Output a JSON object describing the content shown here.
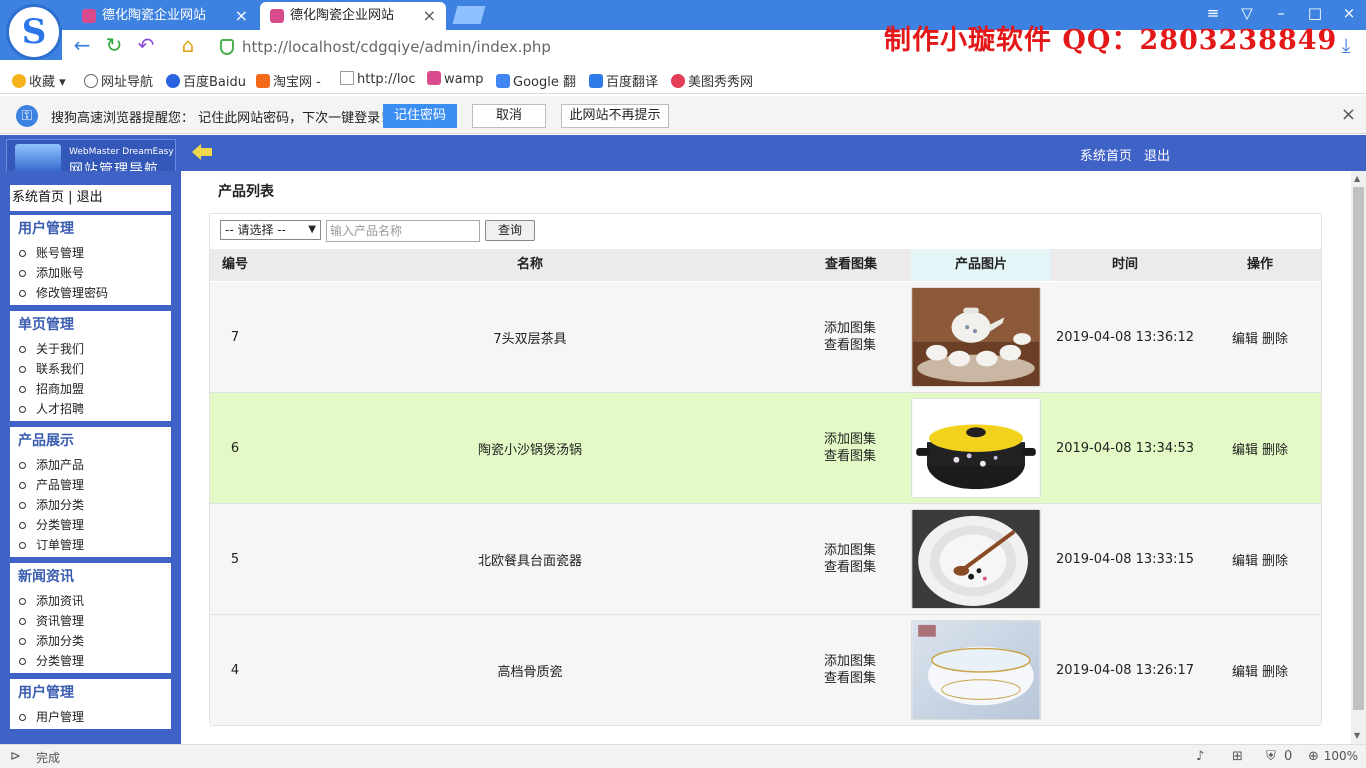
{
  "browser": {
    "logo_letter": "S",
    "tabs": [
      {
        "title": "德化陶瓷企业网站"
      },
      {
        "title": "德化陶瓷企业网站"
      }
    ],
    "url": "http://localhost/cdgqiye/admin/index.php",
    "promo_text": "制作小璇软件 QQ：2803238849",
    "bookmarks": [
      "收藏",
      "网址导航",
      "百度Baidu",
      "淘宝网 -",
      "http://loc",
      "wamp",
      "Google 翻",
      "百度翻译",
      "美图秀秀网"
    ],
    "password_bar": {
      "message": "搜狗高速浏览器提醒您： 记住此网站密码，下次一键登录！",
      "remember": "记住密码",
      "cancel": "取消",
      "never": "此网站不再提示"
    },
    "status": "完成",
    "zoom": "100%",
    "blocked_count": "0"
  },
  "app": {
    "brand_en": "WebMaster DreamEasy",
    "brand_zh": "网站管理导航",
    "top_links": [
      "系统首页",
      "退出"
    ],
    "side_head": [
      "系统首页",
      "退出"
    ],
    "menus": [
      {
        "title": "用户管理",
        "items": [
          "账号管理",
          "添加账号",
          "修改管理密码"
        ]
      },
      {
        "title": "单页管理",
        "items": [
          "关于我们",
          "联系我们",
          "招商加盟",
          "人才招聘"
        ]
      },
      {
        "title": "产品展示",
        "items": [
          "添加产品",
          "产品管理",
          "添加分类",
          "分类管理",
          "订单管理"
        ]
      },
      {
        "title": "新闻资讯",
        "items": [
          "添加资讯",
          "资讯管理",
          "添加分类",
          "分类管理"
        ]
      },
      {
        "title": "用户管理",
        "items": [
          "用户管理"
        ]
      }
    ],
    "page_title": "产品列表",
    "search": {
      "select_value": "-- 请选择 --",
      "placeholder": "输入产品名称",
      "button": "查询"
    },
    "columns": [
      "编号",
      "名称",
      "查看图集",
      "产品图片",
      "时间",
      "操作"
    ],
    "rows": [
      {
        "id": "7",
        "name": "7头双层茶具",
        "add_gallery": "添加图集",
        "view_gallery": "查看图集",
        "time": "2019-04-08 13:36:12",
        "edit": "编辑",
        "delete": "删除",
        "highlight": false
      },
      {
        "id": "6",
        "name": "陶瓷小沙锅煲汤锅",
        "add_gallery": "添加图集",
        "view_gallery": "查看图集",
        "time": "2019-04-08 13:34:53",
        "edit": "编辑",
        "delete": "删除",
        "highlight": true
      },
      {
        "id": "5",
        "name": "北欧餐具台面瓷器",
        "add_gallery": "添加图集",
        "view_gallery": "查看图集",
        "time": "2019-04-08 13:33:15",
        "edit": "编辑",
        "delete": "删除",
        "highlight": false
      },
      {
        "id": "4",
        "name": "高档骨质瓷",
        "add_gallery": "添加图集",
        "view_gallery": "查看图集",
        "time": "2019-04-08 13:26:17",
        "edit": "编辑",
        "delete": "删除",
        "highlight": false
      }
    ]
  },
  "colors": {
    "chrome_blue": "#3d82e0",
    "app_blue": "#3f62c7",
    "menu_title": "#3a5db0",
    "row_highlight": "#e4fac6",
    "promo_red": "#e41818"
  }
}
